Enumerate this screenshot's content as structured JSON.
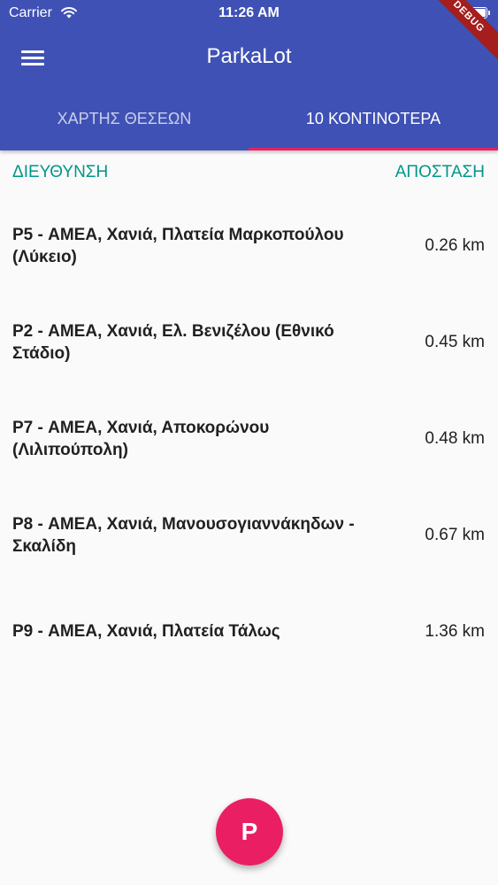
{
  "status_bar": {
    "carrier": "Carrier",
    "time": "11:26 AM",
    "wifi_icon": "wifi-icon",
    "battery_icon": "battery-icon"
  },
  "app_bar": {
    "title": "ParkaLot",
    "menu_icon": "menu-icon",
    "debug_banner": "DEBUG",
    "color": "#3f51b5"
  },
  "tabs": [
    {
      "label": "ΧΑΡΤΗΣ ΘΕΣΕΩΝ",
      "selected": false
    },
    {
      "label": "10 ΚΟΝΤΙΝΟΤΕΡΑ",
      "selected": true
    }
  ],
  "tab_indicator_color": "#e91e63",
  "list_header": {
    "address": "ΔΙΕΥΘΥΝΣΗ",
    "distance": "ΑΠΟΣΤΑΣΗ",
    "color": "#009688"
  },
  "rows": [
    {
      "address": "P5 - ΑΜΕΑ, Χανιά, Πλατεία Μαρκοπούλου (Λύκειο)",
      "distance": "0.26 km"
    },
    {
      "address": "P2 - ΑΜΕΑ, Χανιά, Ελ. Βενιζέλου (Εθνικό Στάδιο)",
      "distance": "0.45 km"
    },
    {
      "address": "P7 - ΑΜΕΑ, Χανιά, Αποκορώνου (Λιλιπούπολη)",
      "distance": "0.48 km"
    },
    {
      "address": "P8 - ΑΜΕΑ, Χανιά, Μανουσογιαννάκηδων - Σκαλίδη",
      "distance": "0.67 km"
    },
    {
      "address": "P9 - ΑΜΕΑ, Χανιά, Πλατεία Τάλως",
      "distance": "1.36 km"
    }
  ],
  "fab": {
    "label": "P",
    "color": "#e91e63"
  }
}
